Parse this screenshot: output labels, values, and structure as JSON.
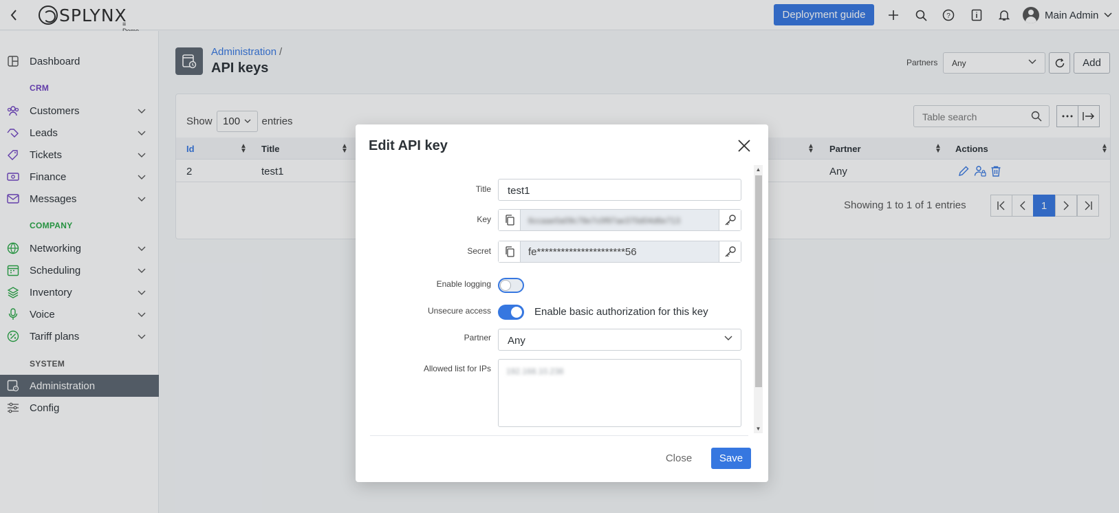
{
  "topbar": {
    "logo_text": "SPLYNX",
    "logo_sub": "≡ Demo",
    "deploy_label": "Deployment guide",
    "user_name": "Main Admin",
    "icons": [
      "back-icon",
      "plus-icon",
      "search-icon",
      "help-icon",
      "info-book-icon",
      "bell-icon",
      "user-avatar-icon",
      "chevron-down-icon"
    ]
  },
  "sidebar": {
    "dashboard": "Dashboard",
    "crm_title": "CRM",
    "customers": "Customers",
    "leads": "Leads",
    "tickets": "Tickets",
    "finance": "Finance",
    "messages": "Messages",
    "company_title": "COMPANY",
    "networking": "Networking",
    "scheduling": "Scheduling",
    "inventory": "Inventory",
    "voice": "Voice",
    "tariff_plans": "Tariff plans",
    "system_title": "SYSTEM",
    "administration": "Administration",
    "config": "Config",
    "colors": {
      "crm": "#6f42c1",
      "company": "#28a745",
      "active_bg": "#5c6670"
    }
  },
  "page": {
    "breadcrumb": "Administration",
    "breadcrumb_sep": "/",
    "title": "API keys",
    "partners_label": "Partners",
    "partners_value": "Any",
    "add_label": "Add"
  },
  "table": {
    "show_label": "Show",
    "show_value": "100",
    "entries_label": "entries",
    "search_placeholder": "Table search",
    "headers": {
      "id": "Id",
      "title": "Title",
      "partner": "Partner",
      "actions": "Actions"
    },
    "rows": [
      {
        "id": "2",
        "title": "test1",
        "partner": "Any"
      }
    ],
    "showing": "Showing 1 to 1 of 1 entries",
    "current_page": "1"
  },
  "modal": {
    "title": "Edit API key",
    "title_label": "Title",
    "title_value": "test1",
    "key_label": "Key",
    "key_value": "6ccaae0a09c78e7c0f97ae370d04d6e713",
    "secret_label": "Secret",
    "secret_value": "fe**********************56",
    "logging_label": "Enable logging",
    "logging_on": false,
    "unsecure_label": "Unsecure access",
    "unsecure_on": true,
    "unsecure_text": "Enable basic authorization for this key",
    "partner_label": "Partner",
    "partner_value": "Any",
    "ips_label": "Allowed list for IPs",
    "ips_value": "192.168.10.238",
    "close_label": "Close",
    "save_label": "Save"
  }
}
